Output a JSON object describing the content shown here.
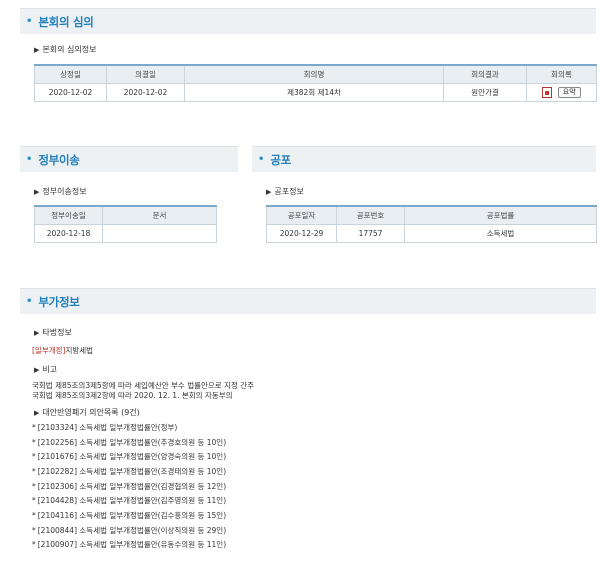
{
  "plenary": {
    "header": "본회의 심의",
    "subtitle": "본회의 심의정보",
    "columns": [
      "상정일",
      "의결일",
      "회의명",
      "회의결과",
      "회의록"
    ],
    "row": {
      "proposed": "2020-12-02",
      "decided": "2020-12-02",
      "meeting": "제382회 제14차",
      "result": "원안가결",
      "minutes_button": "요약"
    }
  },
  "govt_transfer": {
    "header": "정부이송",
    "subtitle": "정부이송정보",
    "columns": [
      "정부이송일",
      "문서"
    ],
    "row": {
      "date": "2020-12-18",
      "doc": ""
    }
  },
  "promulgation": {
    "header": "공포",
    "subtitle": "공포정보",
    "columns": [
      "공포일자",
      "공포번호",
      "공포법률"
    ],
    "row": {
      "date": "2020-12-29",
      "number": "17757",
      "law": "소득세법"
    }
  },
  "additional": {
    "header": "부가정보",
    "other_law_title": "타법정보",
    "other_law_tag": "[일부개정]",
    "other_law_name": "지방세법",
    "note_title": "비고",
    "note_line1": "국회법 제85조의3제5항에 따라 세입예산안 부수 법률안으로 지정 간주",
    "note_line2": "국회법 제85조의3제2항에 따라 2020. 12. 1. 본회의 자동부의",
    "alt_title": "대안반영폐기 의안목록 (9건)",
    "bills": [
      "[2103324] 소득세법 일부개정법률안(정부)",
      "[2102256] 소득세법 일부개정법률안(추경호의원 등 10인)",
      "[2101676] 소득세법 일부개정법률안(양경숙의원 등 10인)",
      "[2102282] 소득세법 일부개정법률안(조경태의원 등 10인)",
      "[2102306] 소득세법 일부개정법률안(김경협의원 등 12인)",
      "[2104428] 소득세법 일부개정법률안(김주영의원 등 11인)",
      "[2104116] 소득세법 일부개정법률안(김수흥의원 등 15인)",
      "[2100844] 소득세법 일부개정법률안(이상직의원 등 29인)",
      "[2100907] 소득세법 일부개정법률안(유동수의원 등 11인)"
    ]
  },
  "colors": {
    "header_bg": "#eef1f4",
    "header_text": "#1f7fba",
    "table_head_bg": "#e9eef3",
    "tag_red": "#b5302a"
  }
}
